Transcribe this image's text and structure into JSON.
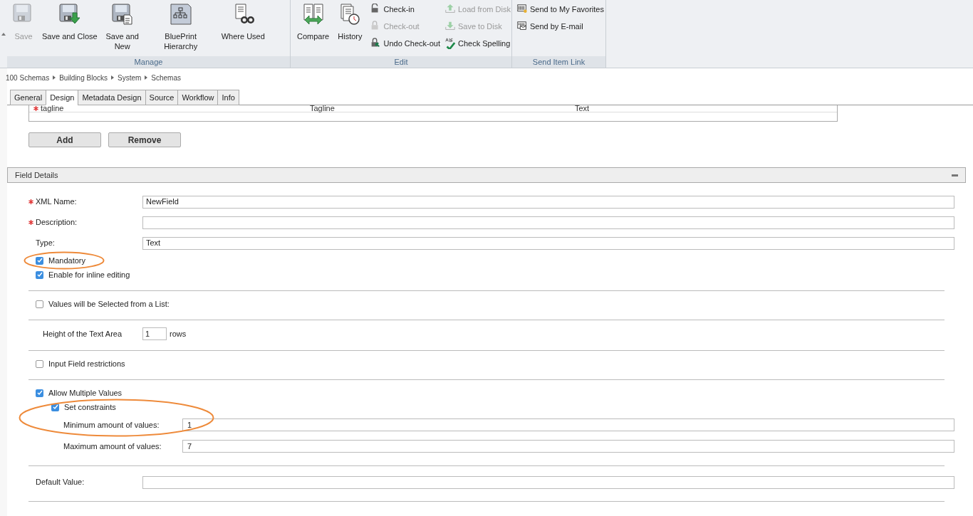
{
  "ribbon": {
    "groups": [
      {
        "label": "Manage",
        "large": [
          {
            "label": "Save",
            "disabled": true
          },
          {
            "label": "Save and Close",
            "disabled": false
          },
          {
            "label": "Save and New",
            "disabled": false
          },
          {
            "label": "BluePrint Hierarchy",
            "disabled": false
          },
          {
            "label": "Where Used",
            "disabled": false
          }
        ]
      },
      {
        "label": "Edit",
        "large": [
          {
            "label": "Compare",
            "disabled": false
          },
          {
            "label": "History",
            "disabled": false
          }
        ],
        "small_columns": [
          [
            {
              "label": "Check-in",
              "disabled": false
            },
            {
              "label": "Check-out",
              "disabled": true
            },
            {
              "label": "Undo Check-out",
              "disabled": false
            }
          ],
          [
            {
              "label": "Load from Disk",
              "disabled": true
            },
            {
              "label": "Save to Disk",
              "disabled": true
            },
            {
              "label": "Check Spelling",
              "disabled": false
            }
          ]
        ]
      },
      {
        "label": "Send Item Link",
        "small_columns": [
          [
            {
              "label": "Send to My Favorites",
              "disabled": false
            },
            {
              "label": "Send by E-mail",
              "disabled": false
            }
          ]
        ]
      }
    ]
  },
  "breadcrumb": [
    "100 Schemas",
    "Building Blocks",
    "System",
    "Schemas"
  ],
  "tabs": [
    {
      "label": "General",
      "selected": false
    },
    {
      "label": "Design",
      "selected": true
    },
    {
      "label": "Metadata Design",
      "selected": false
    },
    {
      "label": "Source",
      "selected": false
    },
    {
      "label": "Workflow",
      "selected": false
    },
    {
      "label": "Info",
      "selected": false
    }
  ],
  "fields_table": {
    "rows": [
      {
        "required": true,
        "cells": [
          "tagline",
          "Tagline",
          "Text"
        ]
      }
    ]
  },
  "buttons": [
    "Add",
    "Remove"
  ],
  "field_details": {
    "title": "Field Details",
    "items": [
      {
        "kind": "field",
        "label": "XML Name:",
        "required": true,
        "value": "NewField"
      },
      {
        "kind": "field",
        "label": "Description:",
        "required": true
      },
      {
        "kind": "field",
        "label": "Type:",
        "required": false,
        "value": "Text"
      },
      {
        "kind": "checkbox",
        "label": "Mandatory",
        "checked": true,
        "circled": true
      },
      {
        "kind": "checkbox",
        "label": "Enable for inline editing",
        "checked": true,
        "circled": false
      },
      {
        "kind": "divider"
      },
      {
        "kind": "checkbox",
        "label": "Values will be Selected from a List:",
        "checked": false,
        "circled": false
      },
      {
        "kind": "divider"
      },
      {
        "kind": "rows",
        "label": "Height of the Text Area",
        "value": "1",
        "suffix": "rows"
      },
      {
        "kind": "divider"
      },
      {
        "kind": "checkbox",
        "label": "Input Field restrictions",
        "checked": false,
        "circled": false
      },
      {
        "kind": "divider"
      },
      {
        "kind": "checkbox",
        "label": "Allow Multiple Values",
        "checked": true,
        "circled": false
      },
      {
        "kind": "group",
        "circled": true,
        "children": [
          {
            "kind": "checkbox",
            "label": "Set constraints",
            "checked": true
          },
          {
            "kind": "subfield",
            "label": "Minimum amount of values:",
            "value": "1"
          }
        ]
      },
      {
        "kind": "subfield",
        "label": "Maximum amount of values:",
        "value": "7"
      },
      {
        "kind": "divider"
      },
      {
        "kind": "field",
        "label": "Default Value:",
        "required": false
      },
      {
        "kind": "divider"
      }
    ]
  }
}
